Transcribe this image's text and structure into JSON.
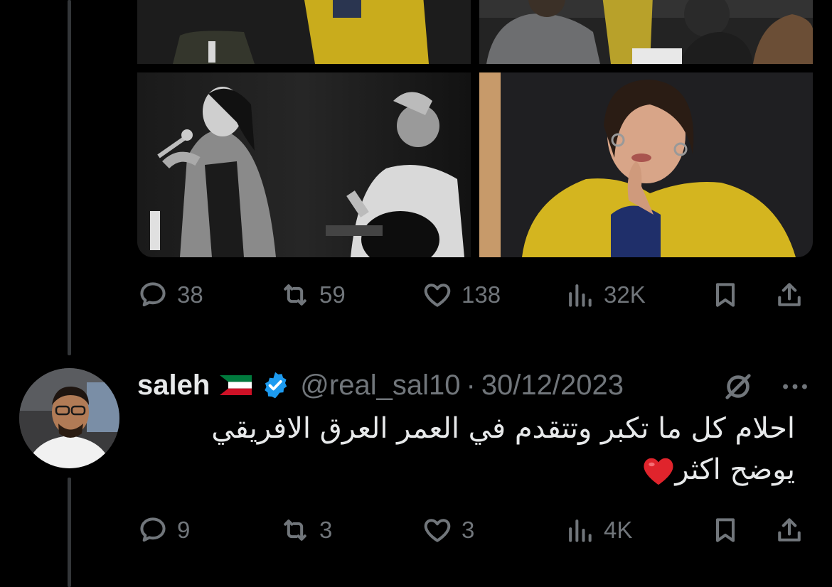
{
  "tweet_1": {
    "metrics": {
      "replies": "38",
      "reposts": "59",
      "likes": "138",
      "views": "32K"
    }
  },
  "reply": {
    "display_name": "saleh",
    "handle": "@real_sal10",
    "separator": "·",
    "date": "30/12/2023",
    "text_line_1": "احلام كل ما تكبر وتتقدم في العمر العرق الافريقي",
    "text_line_2": "يوضح اكثر",
    "metrics": {
      "replies": "9",
      "reposts": "3",
      "likes": "3",
      "views": "4K"
    }
  },
  "icons": {
    "reply": "speech-bubble-icon",
    "repost": "repost-arrows-icon",
    "like": "heart-outline-icon",
    "views": "bar-chart-icon",
    "bookmark": "bookmark-icon",
    "share": "share-upload-icon",
    "grok": "grok-slash-circle-icon",
    "more": "ellipsis-icon",
    "verified": "verified-badge-icon",
    "flag": "kuwait-flag-icon"
  },
  "colors": {
    "background": "#000000",
    "text_primary": "#e7e9ea",
    "text_secondary": "#71767b",
    "verified_blue": "#1d9bf0",
    "thread_line": "#333639"
  }
}
